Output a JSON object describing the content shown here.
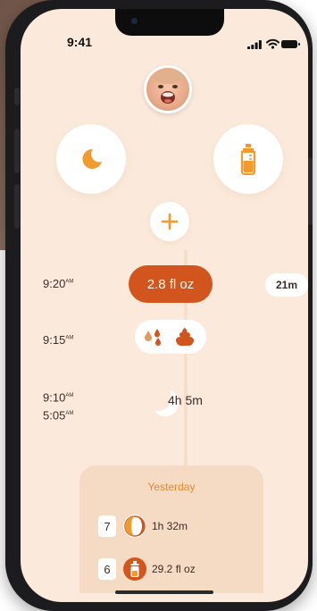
{
  "status_bar": {
    "time": "9:41"
  },
  "colors": {
    "accent": "#d2551d",
    "accent_light": "#f39a2d",
    "background": "#fbeadb",
    "card": "#f5dbc4"
  },
  "icons": {
    "sleep": "moon-icon",
    "feeding": "bottle-icon",
    "add": "plus-icon",
    "diaper_wet": "droplets-icon",
    "diaper_dirty": "poop-icon"
  },
  "timeline": {
    "feed": {
      "time": "9:20",
      "ampm": "AM",
      "amount": "2.8 fl oz",
      "duration": "21m"
    },
    "diaper": {
      "time": "9:15",
      "ampm": "AM"
    },
    "sleep": {
      "end_time": "9:10",
      "end_ampm": "AM",
      "start_time": "5:05",
      "start_ampm": "AM",
      "duration": "4h 5m"
    }
  },
  "yesterday": {
    "title": "Yesterday",
    "rows": [
      {
        "count": "7",
        "icon": "sleep-half-moon-icon",
        "value": "1h 32m"
      },
      {
        "count": "6",
        "icon": "bottle-icon",
        "value": "29.2 fl oz"
      }
    ]
  }
}
